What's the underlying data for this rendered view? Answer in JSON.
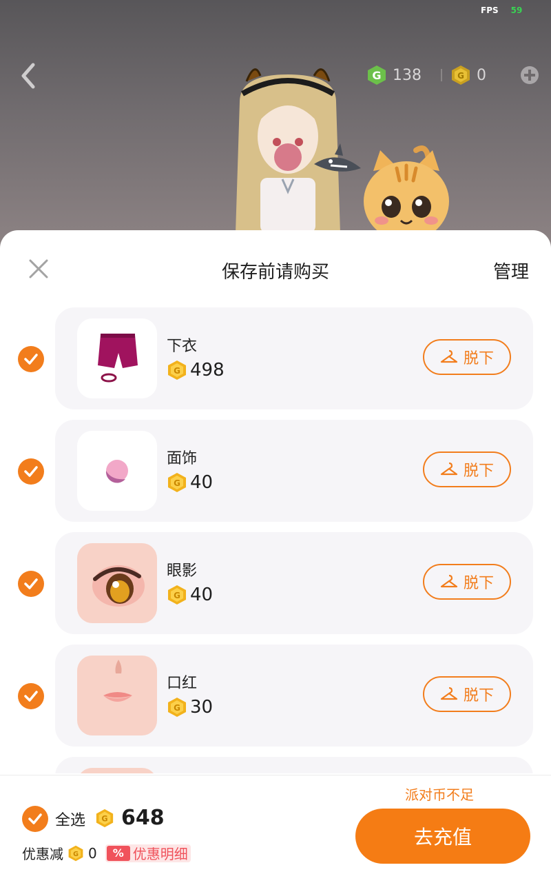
{
  "status": {
    "fps_label": "FPS",
    "fps_value": "59"
  },
  "top_bar": {
    "g_coin_value": "138",
    "gold_coin_value": "0"
  },
  "sheet": {
    "title": "保存前请购买",
    "manage_label": "管理"
  },
  "items": [
    {
      "name": "下衣",
      "price": "498",
      "action_label": "脱下",
      "checked": true,
      "icon": "pink-shorts-icon"
    },
    {
      "name": "面饰",
      "price": "40",
      "action_label": "脱下",
      "checked": true,
      "icon": "pink-ball-icon"
    },
    {
      "name": "眼影",
      "price": "40",
      "action_label": "脱下",
      "checked": true,
      "icon": "eye-shadow-icon"
    },
    {
      "name": "口红",
      "price": "30",
      "action_label": "脱下",
      "checked": true,
      "icon": "lipstick-icon"
    }
  ],
  "footer": {
    "insufficient_text": "派对币不足",
    "select_all_label": "全选",
    "total_value": "648",
    "discount_label": "优惠减",
    "discount_value": "0",
    "discount_badge": "%",
    "discount_detail_label": "优惠明细",
    "recharge_label": "去充值"
  },
  "colors": {
    "accent": "#f27d1c",
    "recharge_button": "#f57c14",
    "card_background": "#f6f5f8",
    "discount_red": "#f0525b",
    "coin_gold": "#f2b21c",
    "coin_green": "#6cc04a"
  }
}
